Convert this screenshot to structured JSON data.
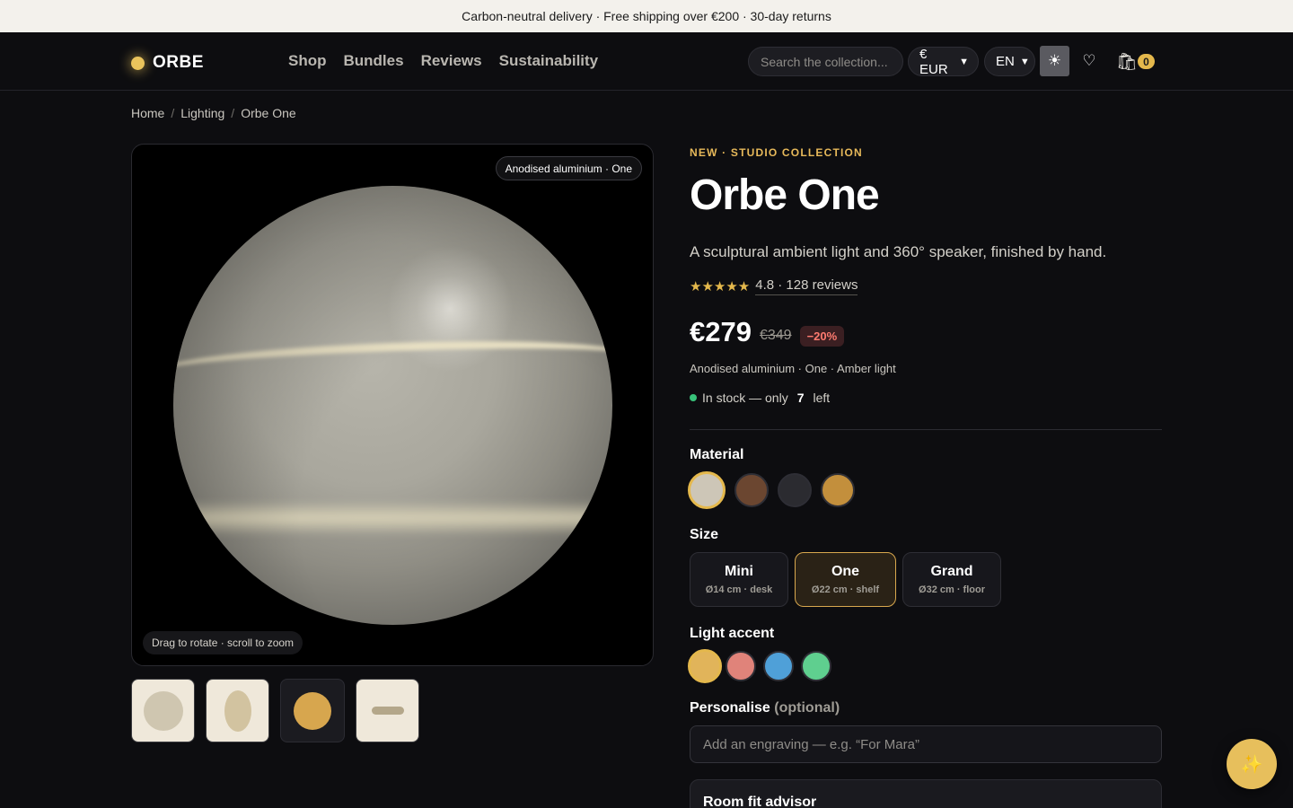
{
  "announcement": "Carbon-neutral delivery · Free shipping over €200 · 30-day returns",
  "brand": {
    "name": "ORBE",
    "dot_color": "#e9c35c"
  },
  "nav": {
    "items": [
      "Shop",
      "Bundles",
      "Reviews",
      "Sustainability"
    ]
  },
  "header": {
    "search_placeholder": "Search the collection...",
    "currency": "€ EUR",
    "language": "EN",
    "theme_icon": "sun-icon",
    "wishlist_icon": "heart-icon",
    "cart_icon": "shopping-bag-icon",
    "cart_count": "0"
  },
  "breadcrumb": [
    "Home",
    "Lighting",
    "Orbe One"
  ],
  "viewer": {
    "badge": "Anodised aluminium · One",
    "hint": "Drag to rotate · scroll to zoom"
  },
  "thumbnails": [
    "sphere-front",
    "sphere-side",
    "sphere-glow",
    "sphere-top"
  ],
  "product": {
    "eyebrow": "NEW · STUDIO COLLECTION",
    "title": "Orbe One",
    "subtitle": "A sculptural ambient light and 360° speaker, finished by hand.",
    "stars": "★★★★★",
    "rating_text": "4.8 · 128 reviews",
    "price": "€279",
    "old_price": "€349",
    "discount": "−20%",
    "variant_summary": "Anodised aluminium · One · Amber light",
    "stock_prefix": "In stock — only",
    "stock_count": "7",
    "stock_suffix": "left"
  },
  "material": {
    "label": "Material",
    "swatches": [
      "#cdc6b7",
      "#6b4630",
      "#2b2b30",
      "#c38f3c"
    ],
    "selected": 0
  },
  "size": {
    "label": "Size",
    "options": [
      {
        "name": "Mini",
        "detail": "Ø14 cm · desk"
      },
      {
        "name": "One",
        "detail": "Ø22 cm · shelf"
      },
      {
        "name": "Grand",
        "detail": "Ø32 cm · floor"
      }
    ],
    "selected": 1
  },
  "accent": {
    "label": "Light accent",
    "swatches": [
      "#e1b45a",
      "#e0837a",
      "#4fa0d8",
      "#5fcf8f"
    ],
    "selected": 0
  },
  "personalise": {
    "label": "Personalise",
    "optional": "(optional)",
    "placeholder": "Add an engraving — e.g. “For Mara”"
  },
  "advisor": {
    "title": "Room fit advisor"
  },
  "fab_icon": "sparkles-icon"
}
